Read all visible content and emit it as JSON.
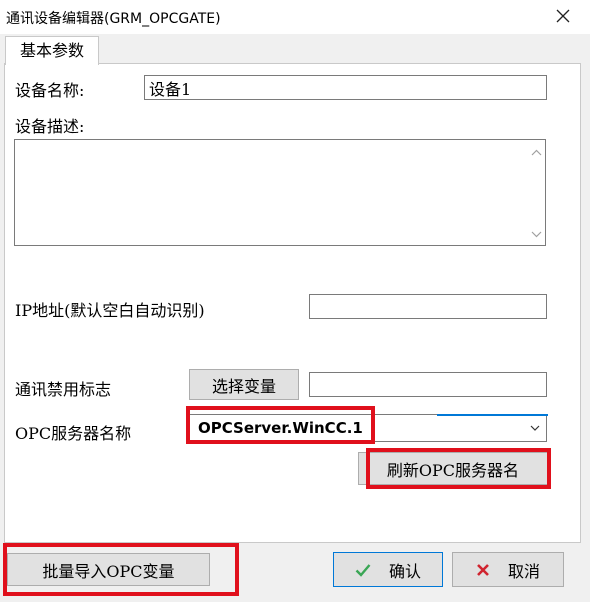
{
  "window": {
    "title": "通讯设备编辑器(GRM_OPCGATE)",
    "close_icon": "close-icon"
  },
  "tabs": [
    {
      "label": "基本参数"
    }
  ],
  "form": {
    "device_name_label": "设备名称:",
    "device_name_value": "设备1",
    "device_desc_label": "设备描述:",
    "device_desc_value": "",
    "ip_label": "IP地址(默认空白自动识别)",
    "ip_value": "",
    "comm_disable_label": "通讯禁用标志",
    "select_var_button": "选择变量",
    "comm_disable_value": "",
    "opc_server_label": "OPC服务器名称",
    "opc_server_value": "OPCServer.WinCC.1",
    "refresh_button": "刷新OPC服务器名"
  },
  "footer": {
    "batch_import_button": "批量导入OPC变量",
    "ok_button": "确认",
    "cancel_button": "取消"
  },
  "colors": {
    "highlight_box": "#e0101c",
    "ok_icon": "#3aa655",
    "cancel_icon": "#d0242f",
    "accent": "#0078d7"
  }
}
